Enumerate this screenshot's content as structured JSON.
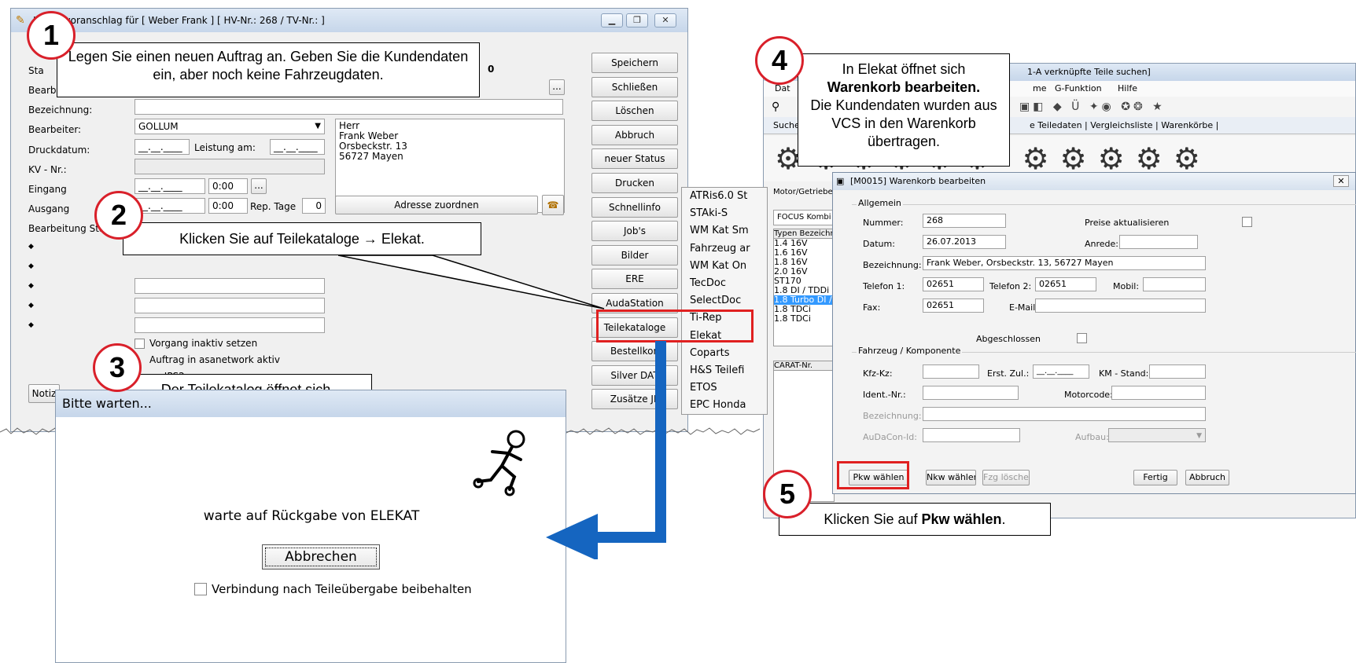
{
  "left_window": {
    "title": "Kostenvoranschlag  für [ Weber Frank ]  [ HV-Nr.: 268 / TV-Nr.:  ]",
    "labels": {
      "status": "Sta",
      "bearbeiter_short": "Bearbe",
      "bezeichnung": "Bezeichnung:",
      "bearbeiter": "Bearbeiter:",
      "druckdatum": "Druckdatum:",
      "leistung_am": "Leistung am:",
      "kv_nr": "KV - Nr.:",
      "eingang": "Eingang",
      "ausgang": "Ausgang",
      "rep_tage": "Rep. Tage",
      "bearbeitung_start": "Bearbeitung Star",
      "notiz_tab": "Notiz"
    },
    "values": {
      "status_value": "0",
      "bearbeiter": "GOLLUM",
      "druckdatum": "__.__.____",
      "leistung_am": "__.__.____",
      "eingang_date": "__.__.____",
      "eingang_time": "0:00",
      "ausgang_date": "__.__.____",
      "ausgang_time": "0:00",
      "rep_tage": "0",
      "address_lines": [
        "Herr",
        "Frank Weber",
        "Orsbeckstr. 13",
        "56727 Mayen"
      ],
      "ellipsis": "..."
    },
    "adresse_button": "Adresse zuordnen",
    "checkboxes": [
      "Vorgang inaktiv setzen",
      "Auftrag in asanetwork aktiv",
      "an IPS2"
    ],
    "bullets": [
      "◆",
      "◆",
      "◆",
      "◆",
      "◆"
    ],
    "side_buttons": [
      "Speichern",
      "Schließen",
      "Löschen",
      "Abbruch",
      "neuer Status",
      "Drucken",
      "Schnellinfo",
      "Job's",
      "Bilder",
      "ERE",
      "AudaStation",
      "Teilekataloge",
      "Bestellkon",
      "Silver DAT",
      "Zusätze JP"
    ]
  },
  "catalog_menu": [
    "ATRis6.0 St",
    "STAki-S",
    "WM Kat Sm",
    "Fahrzeug ar",
    "WM Kat On",
    "TecDoc",
    "SelectDoc",
    "Ti-Rep",
    "Elekat",
    "Coparts",
    "H&S Teilefi",
    "ETOS",
    "EPC Honda"
  ],
  "wait_dialog": {
    "title": "Bitte warten...",
    "message": "warte auf Rückgabe von ELEKAT",
    "cancel_button": "Abbrechen",
    "checkbox_label": "Verbindung nach Teileübergabe beibehalten"
  },
  "elekat_window": {
    "title": "1-A verknüpfte Teile suchen]",
    "menu": [
      "Dat",
      "me",
      "G-Funktion",
      "Hilfe"
    ],
    "tabs_fragment": "e Teiledaten  |  Vergleichsliste  |  Warenkörbe  |",
    "tab_suche": "Suche",
    "left_panel": {
      "motor_label": "Motor/Getriebe",
      "model": "FOCUS Kombi",
      "list_header": "Typen Bezeichnu",
      "types": [
        "1.4 16V",
        "1.6 16V",
        "1.8 16V",
        "2.0 16V",
        "ST170",
        "1.8 DI / TDDi",
        "1.8 Turbo DI / TD",
        "1.8 TDCi",
        "1.8 TDCi"
      ],
      "selected_index": 6,
      "carat_header": "CARAT-Nr."
    }
  },
  "warenkorb": {
    "title": "[M0015] Warenkorb bearbeiten",
    "section_allgemein": "Allgemein",
    "fields": {
      "nummer_label": "Nummer:",
      "nummer": "268",
      "preise_label": "Preise aktualisieren",
      "datum_label": "Datum:",
      "datum": "26.07.2013",
      "anrede_label": "Anrede:",
      "bezeichnung_label": "Bezeichnung:",
      "bezeichnung": "Frank Weber, Orsbeckstr. 13, 56727 Mayen",
      "telefon1_label": "Telefon 1:",
      "telefon1": "02651",
      "telefon2_label": "Telefon 2:",
      "telefon2": "02651",
      "mobil_label": "Mobil:",
      "fax_label": "Fax:",
      "fax": "02651",
      "email_label": "E-Mail:",
      "abgeschlossen_label": "Abgeschlossen"
    },
    "section_fahrzeug": "Fahrzeug / Komponente",
    "vehicle": {
      "kfz_label": "Kfz-Kz:",
      "erst_zul_label": "Erst. Zul.:",
      "erst_zul": "__.__.____",
      "km_label": "KM - Stand:",
      "ident_label": "Ident.-Nr.:",
      "motorcode_label": "Motorcode:",
      "bezeichnung_label": "Bezeichnung:",
      "audacon_label": "AuDaCon-Id:",
      "aufbau_label": "Aufbau:"
    },
    "buttons": {
      "pkw": "Pkw wählen",
      "nkw": "Nkw wählen",
      "fzg": "Fzg löschen",
      "fertig": "Fertig",
      "abbruch": "Abbruch"
    }
  },
  "callouts": {
    "c1": {
      "num": "1",
      "text": "Legen Sie einen neuen Auftrag an. Geben Sie die Kundendaten ein, aber noch keine Fahrzeugdaten."
    },
    "c2": {
      "num": "2",
      "text": "Klicken Sie auf Teilekataloge → Elekat."
    },
    "c3": {
      "num": "3",
      "text": "Der Teilekatalog öffnet sich."
    },
    "c4": {
      "num": "4",
      "text_1": "In Elekat öffnet sich",
      "text_bold": "Warenkorb bearbeiten.",
      "text_2": "Die Kundendaten wurden aus VCS in den Warenkorb übertragen."
    },
    "c5": {
      "num": "5",
      "text_pre": "Klicken Sie auf ",
      "text_bold": "Pkw wählen",
      "text_post": "."
    }
  },
  "colors": {
    "badge_border": "#d9202a",
    "highlight": "#e02020",
    "arrow": "#1565c0",
    "selection": "#3399ff"
  }
}
